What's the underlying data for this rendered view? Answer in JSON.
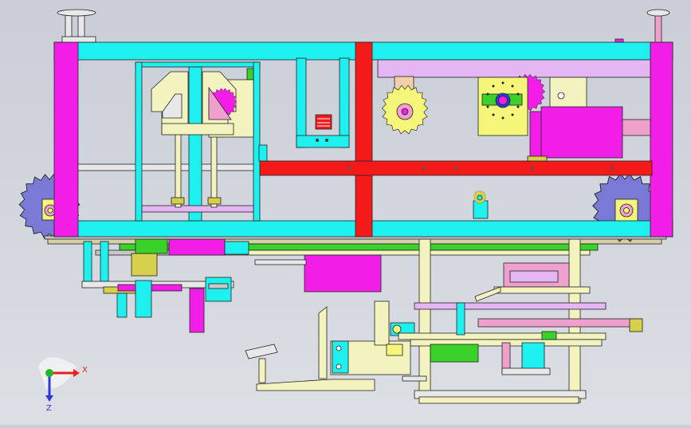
{
  "viewport": {
    "background_top": "#c9ced8",
    "background_bottom": "#dcdfe4"
  },
  "triad": {
    "x_label": "X",
    "z_label": "Z",
    "x_color": "#e8201e",
    "y_color": "#28b42a",
    "z_color": "#2d3bd6"
  },
  "palette": {
    "frame_cyan": "#1ef0f0",
    "frame_magenta": "#f21ee8",
    "rail_red": "#f51a1a",
    "pink": "#f0a0cc",
    "lavender": "#e4b6f2",
    "gear_blue": "#7a7ad6",
    "yellow": "#f5f57a",
    "cream": "#f3f3c0",
    "green": "#3ad22a",
    "dark_yellow": "#d6d04a",
    "outline": "#222222"
  }
}
